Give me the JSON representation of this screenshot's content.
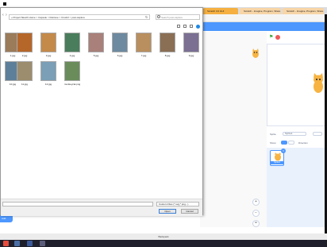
{
  "browser": {
    "tabs": [
      {
        "label": "Scratch 3.0 GUI",
        "color": "#f5b041"
      },
      {
        "label": "Scratch - Imagine, Program, Share",
        "color": "#f8d5a6"
      },
      {
        "label": "Scratch - Imagine, Program, Share",
        "color": "#f8d5a6"
      }
    ]
  },
  "dialog": {
    "path": "« Project Sketch Home > Capsule > Retrieve > Crush2 > post-capture",
    "search_placeholder": "Search post-capture",
    "files": [
      {
        "name": "1.jpg",
        "color": "#9a7b5a"
      },
      {
        "name": "2.jpg",
        "color": "#b5672a"
      },
      {
        "name": "3.jpg",
        "color": "#c48a4a"
      },
      {
        "name": "4.jpg",
        "color": "#4a7d5c"
      },
      {
        "name": "5.jpg",
        "color": "#a9807a"
      },
      {
        "name": "6.jpg",
        "color": "#6d8aa0"
      },
      {
        "name": "7.jpg",
        "color": "#b98f5f"
      },
      {
        "name": "8.jpg",
        "color": "#8a6f55"
      },
      {
        "name": "9.jpg",
        "color": "#7b6f92"
      },
      {
        "name": "10.jpg",
        "color": "#5e7f99"
      },
      {
        "name": "11.jpg",
        "color": "#9b8d6d"
      },
      {
        "name": "12.jpg",
        "color": "#7a9fb6"
      },
      {
        "name": "monkeycat.png",
        "color": "#6a8c5a"
      }
    ],
    "file_type": "Custom Files (*.svg;*.png...)",
    "open_label": "Open",
    "cancel_label": "Cancel"
  },
  "scratch": {
    "sprite_label": "Sprite",
    "sprite_value": "Sprite1",
    "show_label": "Show",
    "size_label": "Size",
    "direction_label": "Direction",
    "sprite_thumb_label": "Sprite1",
    "blue_button_label": "Add"
  },
  "bottom_bar": {
    "text": "Backpack"
  },
  "colors": {
    "scratch_blue": "#4d97ff",
    "taskbar": "#1f1f2b"
  }
}
